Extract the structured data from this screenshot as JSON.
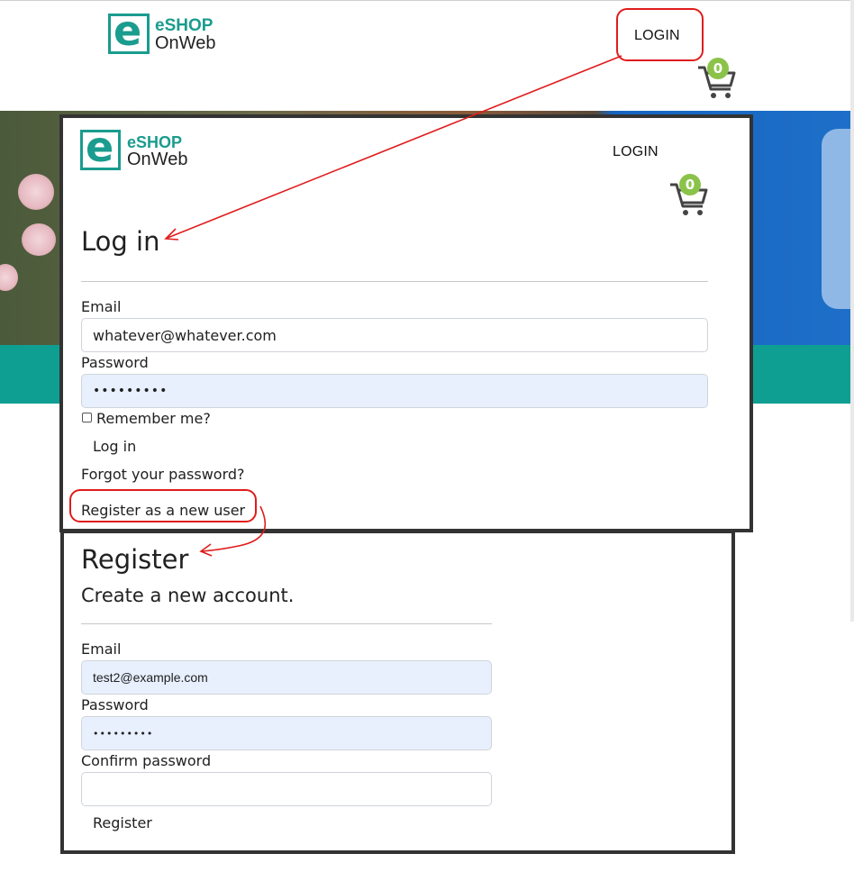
{
  "header": {
    "logo_line1": "eSHOP",
    "logo_line2": "OnWeb",
    "logo_letter": "e",
    "login_label": "LOGIN",
    "cart_count": "0"
  },
  "login_panel": {
    "logo_line1": "eSHOP",
    "logo_line2": "OnWeb",
    "logo_letter": "e",
    "login_label": "LOGIN",
    "cart_count": "0",
    "title": "Log in",
    "email_label": "Email",
    "email_value": "whatever@whatever.com",
    "password_label": "Password",
    "password_value": "•••••••••",
    "remember_label": "Remember me?",
    "login_button": "Log in",
    "forgot_link": "Forgot your password?",
    "register_link": "Register as a new user"
  },
  "register_panel": {
    "title": "Register",
    "subtitle": "Create a new account.",
    "email_label": "Email",
    "email_value": "test2@example.com",
    "password_label": "Password",
    "password_value": "•••••••••",
    "confirm_label": "Confirm password",
    "confirm_value": "",
    "register_button": "Register"
  },
  "colors": {
    "brand_teal": "#1a9c8e",
    "teal_band": "#0e9f92",
    "badge_green": "#8bc34a",
    "callout_red": "#e01c1c",
    "panel_border": "#333333",
    "autofill_blue": "#e8f0fe"
  },
  "icons": [
    "logo-e-icon",
    "cart-icon",
    "checkbox-icon",
    "arrow-annotation"
  ]
}
